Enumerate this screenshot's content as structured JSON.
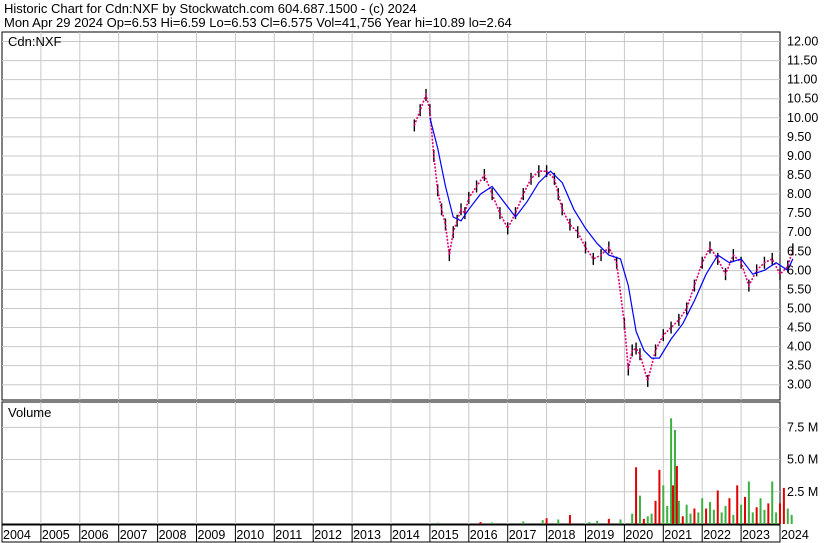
{
  "header": {
    "line1": "Historic Chart for Cdn:NXF by Stockwatch.com 604.687.1500 - (c) 2024",
    "line2": "Mon Apr 29 2024   Op=6.53   Hi=6.59   Lo=6.53   Cl=6.575   Vol=41,756   Year hi=10.89   lo=2.64"
  },
  "price_panel_label": "Cdn:NXF",
  "volume_panel_label": "Volume",
  "colors": {
    "price_bar": "#000000",
    "close_dot": "#e0007a",
    "ma_line": "#0000ff",
    "volume_up": "#3cb043",
    "volume_down": "#e00000",
    "grid": "#c8c8c8"
  },
  "chart_data": [
    {
      "type": "line",
      "panel": "price",
      "ylim": [
        2.6,
        12.25
      ],
      "y_ticks": [
        "12.00",
        "11.50",
        "11.00",
        "10.50",
        "10.00",
        "9.50",
        "9.00",
        "8.50",
        "8.00",
        "7.50",
        "7.00",
        "6.50",
        "6.00",
        "5.50",
        "5.00",
        "4.50",
        "4.00",
        "3.50",
        "3.00"
      ],
      "x_ticks": [
        "2004",
        "2005",
        "2006",
        "2007",
        "2008",
        "2009",
        "2010",
        "2011",
        "2012",
        "2013",
        "2014",
        "2015",
        "2016",
        "2017",
        "2018",
        "2019",
        "2020",
        "2021",
        "2022",
        "2023",
        "2024"
      ],
      "series": [
        {
          "x": [
            2014.6,
            2014.75,
            2014.9,
            2015.0,
            2015.1,
            2015.2,
            2015.3,
            2015.4,
            2015.5,
            2015.6,
            2015.7,
            2015.8,
            2015.9,
            2016.0,
            2016.2,
            2016.4,
            2016.6,
            2016.8,
            2017.0,
            2017.2,
            2017.4,
            2017.6,
            2017.8,
            2018.0,
            2018.2,
            2018.3,
            2018.4,
            2018.6,
            2018.8,
            2019.0,
            2019.2,
            2019.4,
            2019.6,
            2019.8,
            2020.0,
            2020.1,
            2020.2,
            2020.3,
            2020.4,
            2020.6,
            2020.8,
            2021.0,
            2021.2,
            2021.4,
            2021.6,
            2021.8,
            2022.0,
            2022.2,
            2022.4,
            2022.6,
            2022.8,
            2023.0,
            2023.2,
            2023.4,
            2023.6,
            2023.8,
            2024.0,
            2024.2,
            2024.33
          ],
          "values": [
            9.8,
            10.2,
            10.6,
            10.2,
            9.0,
            8.1,
            7.6,
            7.2,
            6.4,
            7.0,
            7.3,
            7.6,
            7.5,
            7.9,
            8.2,
            8.5,
            8.0,
            7.5,
            7.1,
            7.5,
            8.0,
            8.4,
            8.6,
            8.6,
            8.4,
            8.0,
            7.6,
            7.2,
            7.0,
            6.6,
            6.3,
            6.4,
            6.6,
            6.2,
            4.6,
            3.4,
            3.9,
            3.95,
            3.8,
            3.1,
            3.9,
            4.3,
            4.5,
            4.7,
            5.0,
            5.6,
            6.2,
            6.6,
            6.3,
            5.9,
            6.4,
            6.2,
            5.6,
            6.0,
            6.2,
            6.3,
            5.9,
            6.1,
            6.55
          ]
        },
        {
          "x": [
            2015.0,
            2015.2,
            2015.4,
            2015.6,
            2015.8,
            2016.0,
            2016.3,
            2016.6,
            2016.9,
            2017.2,
            2017.5,
            2017.8,
            2018.1,
            2018.4,
            2018.7,
            2019.0,
            2019.3,
            2019.6,
            2019.9,
            2020.1,
            2020.3,
            2020.5,
            2020.7,
            2020.9,
            2021.2,
            2021.5,
            2021.8,
            2022.1,
            2022.4,
            2022.7,
            2023.0,
            2023.3,
            2023.6,
            2023.9,
            2024.2,
            2024.33
          ],
          "values": [
            10.0,
            9.2,
            8.2,
            7.4,
            7.3,
            7.6,
            8.0,
            8.2,
            7.8,
            7.4,
            7.8,
            8.3,
            8.6,
            8.3,
            7.6,
            7.1,
            6.7,
            6.4,
            6.3,
            5.6,
            4.4,
            3.9,
            3.7,
            3.7,
            4.2,
            4.6,
            5.2,
            5.9,
            6.4,
            6.2,
            6.3,
            5.9,
            6.0,
            6.2,
            6.0,
            6.3
          ]
        }
      ]
    },
    {
      "type": "bar",
      "panel": "volume",
      "ylim": [
        0,
        9000000
      ],
      "y_ticks": [
        "7.5 M",
        "5.0 M",
        "2.5 M"
      ],
      "y_tick_values": [
        7500000,
        5000000,
        2500000
      ],
      "x": [
        2015.2,
        2016.3,
        2016.6,
        2017.4,
        2017.9,
        2018.0,
        2018.3,
        2018.6,
        2019.1,
        2019.3,
        2019.6,
        2019.9,
        2020.2,
        2020.3,
        2020.4,
        2020.5,
        2020.6,
        2020.7,
        2020.8,
        2020.9,
        2021.0,
        2021.1,
        2021.2,
        2021.25,
        2021.3,
        2021.35,
        2021.4,
        2021.5,
        2021.6,
        2021.7,
        2021.8,
        2021.9,
        2022.0,
        2022.1,
        2022.2,
        2022.3,
        2022.4,
        2022.5,
        2022.6,
        2022.7,
        2022.8,
        2022.9,
        2023.0,
        2023.1,
        2023.2,
        2023.3,
        2023.4,
        2023.5,
        2023.6,
        2023.7,
        2023.8,
        2023.9,
        2024.0,
        2024.1,
        2024.2,
        2024.3
      ],
      "values": [
        100000,
        150000,
        120000,
        200000,
        300000,
        450000,
        350000,
        700000,
        150000,
        250000,
        400000,
        350000,
        800000,
        4400000,
        2200000,
        400000,
        600000,
        800000,
        1800000,
        4200000,
        3000000,
        1400000,
        8200000,
        3000000,
        7300000,
        4500000,
        1800000,
        600000,
        1500000,
        800000,
        1200000,
        900000,
        2000000,
        1200000,
        1700000,
        1100000,
        2600000,
        900000,
        1400000,
        2000000,
        700000,
        3000000,
        1500000,
        2100000,
        3300000,
        900000,
        1300000,
        2000000,
        1100000,
        1600000,
        3300000,
        900000,
        1600000,
        2800000,
        1200000,
        700000
      ],
      "up": [
        1,
        0,
        1,
        1,
        1,
        0,
        1,
        0,
        1,
        1,
        0,
        1,
        1,
        0,
        1,
        0,
        1,
        1,
        0,
        0,
        1,
        1,
        1,
        0,
        1,
        0,
        1,
        0,
        1,
        1,
        0,
        1,
        1,
        0,
        1,
        1,
        0,
        1,
        1,
        0,
        1,
        0,
        1,
        0,
        1,
        1,
        0,
        1,
        1,
        0,
        1,
        1,
        0,
        0,
        1,
        1
      ]
    }
  ]
}
